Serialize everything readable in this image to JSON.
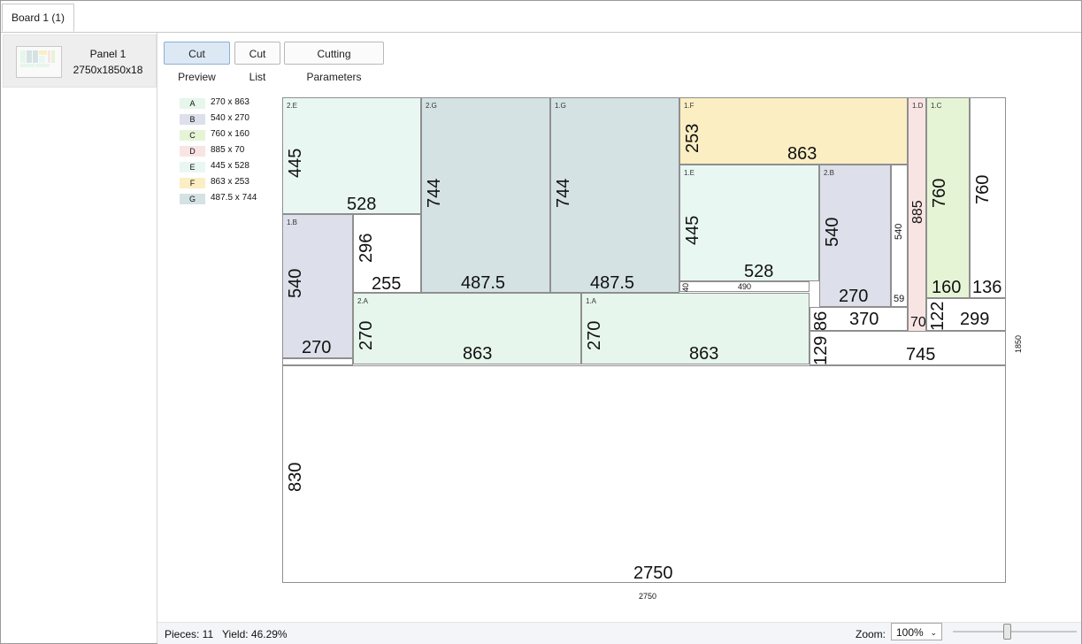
{
  "tabs": [
    {
      "label": "Board 1 (1)"
    }
  ],
  "panels": [
    {
      "name": "Panel 1",
      "dims": "2750x1850x18"
    }
  ],
  "toolbar": {
    "cut_preview": "Cut Preview",
    "cut_list": "Cut List",
    "cutting_parameters": "Cutting Parameters"
  },
  "legend": [
    {
      "code": "A",
      "size": "270 x 863",
      "color": "#e6f6ec"
    },
    {
      "code": "B",
      "size": "540 x 270",
      "color": "#dde0ea"
    },
    {
      "code": "C",
      "size": "760 x 160",
      "color": "#e6f4d6"
    },
    {
      "code": "D",
      "size": "885 x 70",
      "color": "#f9e4e4"
    },
    {
      "code": "E",
      "size": "445 x 528",
      "color": "#e9f7f2"
    },
    {
      "code": "F",
      "size": "863 x 253",
      "color": "#fbeec3"
    },
    {
      "code": "G",
      "size": "487.5 x 744",
      "color": "#d4e2e4"
    }
  ],
  "board": {
    "width": "2750",
    "height": "1850"
  },
  "pieces": [
    {
      "id": "2.E",
      "w": "528",
      "h": "445"
    },
    {
      "id": "2.G",
      "w": "487.5",
      "h": "744"
    },
    {
      "id": "1.G",
      "w": "487.5",
      "h": "744"
    },
    {
      "id": "1.F",
      "w": "863",
      "h": "253"
    },
    {
      "id": "1.D",
      "w": "70",
      "h": "885"
    },
    {
      "id": "1.C",
      "w": "160",
      "h": "760"
    },
    {
      "id": "1.E",
      "w": "528",
      "h": "445"
    },
    {
      "id": "2.B",
      "w": "270",
      "h": "540"
    },
    {
      "id": "1.B",
      "w": "270",
      "h": "540"
    },
    {
      "id": "2.A",
      "w": "863",
      "h": "270"
    },
    {
      "id": "1.A",
      "w": "863",
      "h": "270"
    }
  ],
  "offcuts": [
    {
      "w": "255",
      "h": "296"
    },
    {
      "w": "136",
      "h": "760"
    },
    {
      "w": "59",
      "h": "540"
    },
    {
      "w": "490",
      "h": "40"
    },
    {
      "w": "370",
      "h": "86"
    },
    {
      "w": "299",
      "h": "122"
    },
    {
      "w": "745",
      "h": "129"
    },
    {
      "w": "2750",
      "h": "830"
    }
  ],
  "status": {
    "pieces": "Pieces: 11",
    "yield": "Yield: 46.29%",
    "zoom_label": "Zoom:",
    "zoom_value": "100%"
  }
}
